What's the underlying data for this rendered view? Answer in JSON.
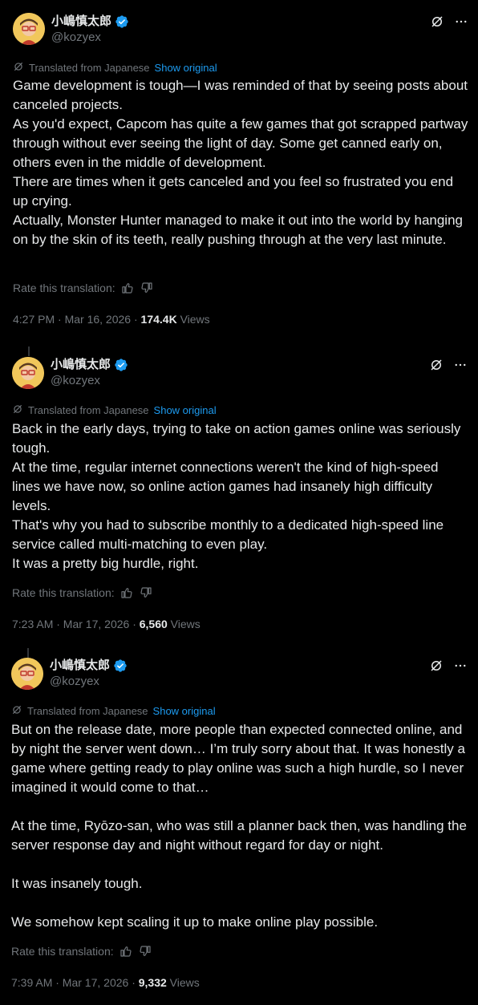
{
  "tweets": [
    {
      "name": "小嶋慎太郎",
      "handle": "@kozyex",
      "translated_label": "Translated from Japanese",
      "show_original": "Show original",
      "paragraphs": [
        "Game development is tough—I was reminded of that by seeing posts about canceled projects.",
        "As you'd expect, Capcom has quite a few games that got scrapped partway through without ever seeing the light of day. Some get canned early on, others even in the middle of development.",
        "There are times when it gets canceled and you feel so frustrated you end up crying.",
        "Actually, Monster Hunter managed to make it out into the world by hanging on by the skin of its teeth, really pushing through at the very last minute."
      ],
      "rate_label": "Rate this translation:",
      "timestamp": "4:27 PM · Mar 16, 2026 · ",
      "views_count": "174.4K",
      "views_label": " Views"
    },
    {
      "name": "小嶋慎太郎",
      "handle": "@kozyex",
      "translated_label": "Translated from Japanese",
      "show_original": "Show original",
      "paragraphs": [
        "Back in the early days, trying to take on action games online was seriously tough.",
        "At the time, regular internet connections weren't the kind of high-speed lines we have now, so online action games had insanely high difficulty levels.",
        "That's why you had to subscribe monthly to a dedicated high-speed line service called multi-matching to even play.",
        "It was a pretty big hurdle, right."
      ],
      "rate_label": "Rate this translation:",
      "timestamp": "7:23 AM · Mar 17, 2026 · ",
      "views_count": "6,560",
      "views_label": " Views"
    },
    {
      "name": "小嶋慎太郎",
      "handle": "@kozyex",
      "translated_label": "Translated from Japanese",
      "show_original": "Show original",
      "paragraphs": [
        "But on the release date, more people than expected connected online, and by night the server went down… I’m truly sorry about that. It was honestly a game where getting ready to play online was such a high hurdle, so I never imagined it would come to that…",
        "",
        "At the time, Ryōzo-san, who was still a planner back then, was handling the server response day and night without regard for day or night.",
        "",
        "It was insanely tough.",
        "",
        "We somehow kept scaling it up to make online play possible."
      ],
      "rate_label": "Rate this translation:",
      "timestamp": "7:39 AM · Mar 17, 2026 · ",
      "views_count": "9,332",
      "views_label": " Views"
    }
  ],
  "colors": {
    "background": "#000000",
    "text": "#e7e9ea",
    "muted": "#71767b",
    "link": "#1d9bf0",
    "verified": "#1d9bf0"
  },
  "icons": [
    "avatar",
    "verified-badge-icon",
    "grok-icon",
    "more-icon",
    "translate-icon",
    "thumbs-up-icon",
    "thumbs-down-icon"
  ]
}
